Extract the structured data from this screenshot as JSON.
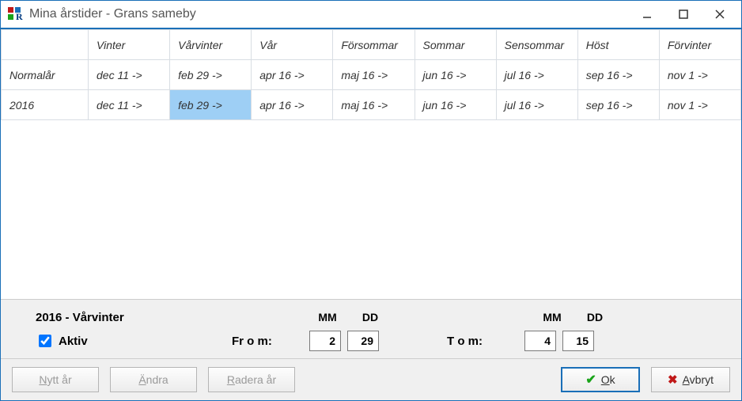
{
  "window": {
    "title": "Mina årstider - Grans sameby"
  },
  "titlebar_buttons": {
    "minimize": "minimize",
    "maximize": "maximize",
    "close": "close"
  },
  "table": {
    "columns": [
      "",
      "Vinter",
      "Vårvinter",
      "Vår",
      "Försommar",
      "Sommar",
      "Sensommar",
      "Höst",
      "Förvinter"
    ],
    "rows": [
      {
        "label": "Normalår",
        "cells": [
          "dec 11 ->",
          "feb 29 ->",
          "apr 16 ->",
          "maj 16 ->",
          "jun 16 ->",
          "jul 16 ->",
          "sep 16 ->",
          "nov 1 ->"
        ]
      },
      {
        "label": "2016",
        "cells": [
          "dec 11 ->",
          "feb 29 ->",
          "apr 16 ->",
          "maj 16 ->",
          "jun 16 ->",
          "jul 16 ->",
          "sep 16 ->",
          "nov 1 ->"
        ]
      }
    ],
    "selected": {
      "row": 1,
      "col": 1
    }
  },
  "editor": {
    "title": "2016 - Vårvinter",
    "mm_label": "MM",
    "dd_label": "DD",
    "aktiv_label": "Aktiv",
    "aktiv_checked": true,
    "from_label": "Fr o m:",
    "tom_label": "T o m:",
    "from_mm": "2",
    "from_dd": "29",
    "tom_mm": "4",
    "tom_dd": "15"
  },
  "buttons": {
    "nytt_ar": "Nytt år",
    "andra": "Ändra",
    "radera_ar": "Radera år",
    "ok": "Ok",
    "avbryt": "Avbryt"
  }
}
